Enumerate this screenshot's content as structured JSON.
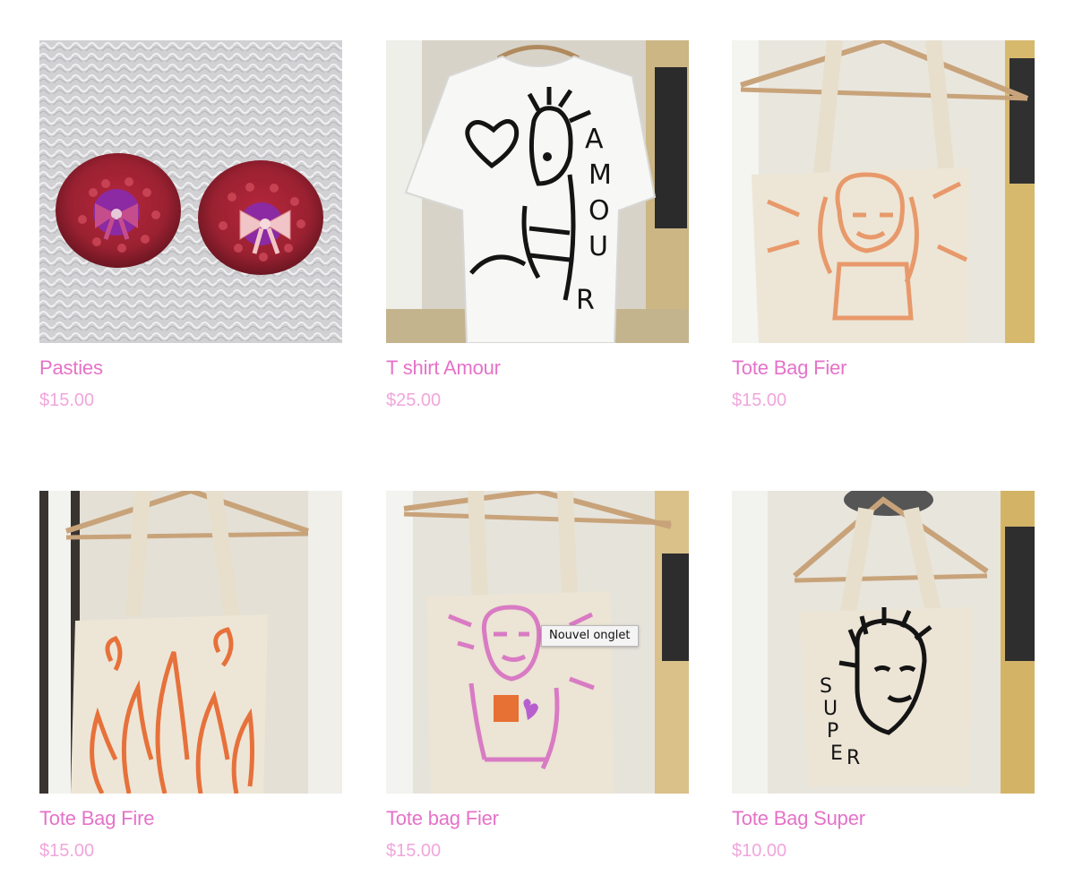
{
  "products": [
    {
      "title": "Pasties",
      "price": "$15.00",
      "image": "pasties-photo"
    },
    {
      "title": "T shirt Amour",
      "price": "$25.00",
      "image": "tshirt-amour-photo"
    },
    {
      "title": "Tote Bag Fier",
      "price": "$15.00",
      "image": "tote-bag-fier-photo"
    },
    {
      "title": "Tote Bag Fire",
      "price": "$15.00",
      "image": "tote-bag-fire-photo"
    },
    {
      "title": "Tote bag Fier",
      "price": "$15.00",
      "image": "tote-bag-fier-pink-photo"
    },
    {
      "title": "Tote Bag Super",
      "price": "$10.00",
      "image": "tote-bag-super-photo"
    }
  ],
  "tooltip": {
    "text": "Nouvel onglet"
  },
  "colors": {
    "title": "#e572c8",
    "price": "#f0a6dc",
    "background": "#ffffff"
  }
}
